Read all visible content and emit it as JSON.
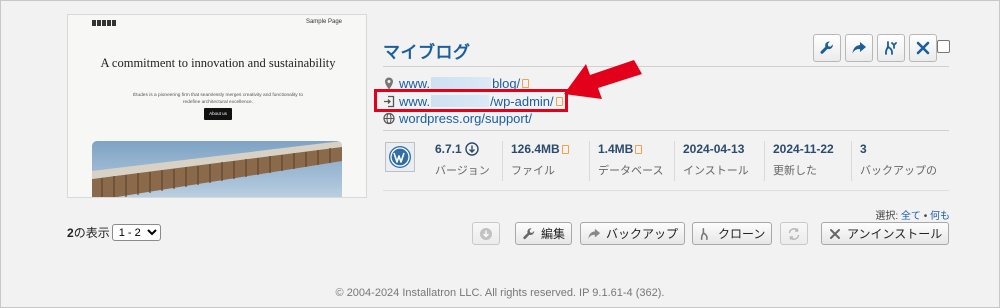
{
  "thumbnail": {
    "nav_link": "Sample Page",
    "headline": "A commitment to innovation and sustainability",
    "body": "Études is a pioneering firm that seamlessly merges creativity and functionality to redefine architectural excellence.",
    "button": "About us"
  },
  "site": {
    "title": "マイブログ",
    "links": {
      "home": {
        "prefix": "www.",
        "suffix": "blog/"
      },
      "admin": {
        "prefix": "www.",
        "suffix": "/wp-admin/"
      },
      "support": {
        "text": "wordpress.org/support/"
      }
    }
  },
  "actions_top": [
    {
      "name": "wrench-icon"
    },
    {
      "name": "share-arrow-icon"
    },
    {
      "name": "clone-icon"
    },
    {
      "name": "close-icon"
    }
  ],
  "stats": {
    "version": {
      "value": "6.7.1",
      "label": "バージョン"
    },
    "files": {
      "value": "126.4MB",
      "label": "ファイル"
    },
    "database": {
      "value": "1.4MB",
      "label": "データベース"
    },
    "installed": {
      "value": "2024-04-13",
      "label": "インストール"
    },
    "updated": {
      "value": "2024-11-22",
      "label": "更新した"
    },
    "backups": {
      "value": "3",
      "label": "バックアップの"
    }
  },
  "pager": {
    "count": "2",
    "label": "の表示",
    "selected": "1 - 2"
  },
  "select_all": {
    "label": "選択:",
    "all": "全て",
    "separator": "•",
    "none": "何も"
  },
  "actions_bottom": {
    "edit": "編集",
    "backup": "バックアップ",
    "clone": "クローン",
    "uninstall": "アンインストール"
  },
  "footer": "© 2004-2024 Installatron LLC. All rights reserved. IP 9.1.61-4 (362).",
  "colors": {
    "accent": "#1b5e9c",
    "highlight": "#e2001a",
    "copy_icon": "#f2a14a"
  }
}
